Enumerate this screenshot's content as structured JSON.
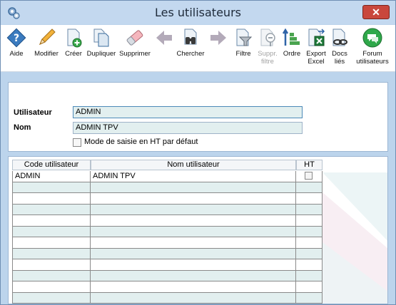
{
  "window": {
    "title": "Les utilisateurs",
    "close_glyph": "✕"
  },
  "toolbar": [
    {
      "label": "Aide",
      "icon": "help-icon"
    },
    {
      "label": "Modifier",
      "icon": "pencil-icon"
    },
    {
      "label": "Créer",
      "icon": "new-document-icon"
    },
    {
      "label": "Dupliquer",
      "icon": "duplicate-icon"
    },
    {
      "label": "Supprimer",
      "icon": "eraser-icon"
    },
    {
      "label": "",
      "icon": "arrow-left-icon"
    },
    {
      "label": "Chercher",
      "icon": "binoculars-icon"
    },
    {
      "label": "",
      "icon": "arrow-right-icon"
    },
    {
      "label": "Filtre",
      "icon": "filter-icon"
    },
    {
      "label": "Suppr.\nfiltre",
      "icon": "remove-filter-icon"
    },
    {
      "label": "Ordre",
      "icon": "sort-order-icon"
    },
    {
      "label": "Export\nExcel",
      "icon": "excel-export-icon"
    },
    {
      "label": "Docs\nliés",
      "icon": "linked-docs-icon"
    },
    {
      "label": "Forum\nutilisateurs",
      "icon": "forum-icon"
    }
  ],
  "form": {
    "user_label": "Utilisateur",
    "user_value": "ADMIN",
    "name_label": "Nom",
    "name_value": "ADMIN TPV",
    "ht_mode_label": "Mode de saisie en HT par défaut",
    "ht_mode_checked": false
  },
  "grid": {
    "columns": [
      "Code utilisateur",
      "Nom utilisateur",
      "HT"
    ],
    "rows": [
      {
        "code": "ADMIN",
        "name": "ADMIN TPV",
        "ht": false
      },
      {
        "code": "",
        "name": "",
        "ht": null
      },
      {
        "code": "",
        "name": "",
        "ht": null
      },
      {
        "code": "",
        "name": "",
        "ht": null
      },
      {
        "code": "",
        "name": "",
        "ht": null
      },
      {
        "code": "",
        "name": "",
        "ht": null
      },
      {
        "code": "",
        "name": "",
        "ht": null
      },
      {
        "code": "",
        "name": "",
        "ht": null
      },
      {
        "code": "",
        "name": "",
        "ht": null
      },
      {
        "code": "",
        "name": "",
        "ht": null
      },
      {
        "code": "",
        "name": "",
        "ht": null
      },
      {
        "code": "",
        "name": "",
        "ht": null
      }
    ]
  },
  "colors": {
    "titlebar": "#c3d8ef",
    "close": "#c9473c",
    "field_bg": "#e2efef",
    "row_alt": "#e2efef",
    "focus_border": "#4c8ab8"
  }
}
